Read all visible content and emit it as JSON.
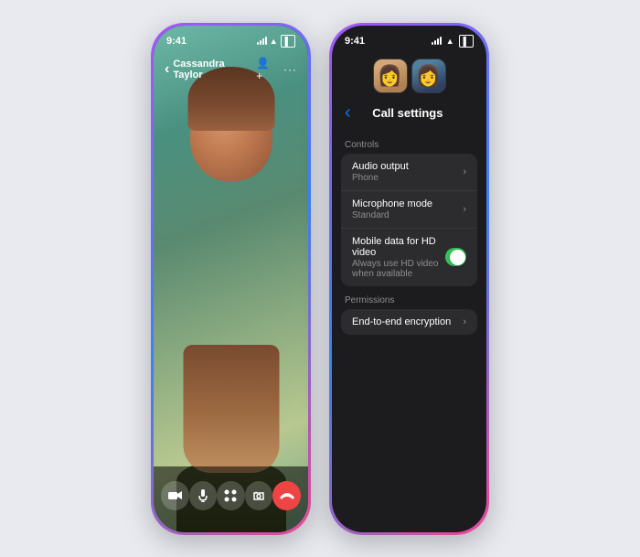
{
  "page": {
    "bg_color": "#e8eaf0"
  },
  "left_phone": {
    "status_bar": {
      "time": "9:41",
      "signal": "signal",
      "wifi": "wifi",
      "battery": "battery"
    },
    "call_header": {
      "back_label": "‹",
      "caller_name": "Cassandra Taylor",
      "add_person_icon": "add-person",
      "more_icon": "more"
    },
    "controls": [
      {
        "id": "camera",
        "icon": "🎥",
        "label": "camera-button"
      },
      {
        "id": "mic",
        "icon": "🎤",
        "label": "mic-button"
      },
      {
        "id": "effects",
        "icon": "⊞",
        "label": "effects-button"
      },
      {
        "id": "flip",
        "icon": "📷",
        "label": "flip-camera-button"
      },
      {
        "id": "end",
        "icon": "📞",
        "label": "end-call-button"
      }
    ]
  },
  "right_phone": {
    "status_bar": {
      "time": "9:41"
    },
    "header": {
      "back_label": "‹",
      "title": "Call settings"
    },
    "sections": [
      {
        "label": "Controls",
        "rows": [
          {
            "title": "Audio output",
            "subtitle": "Phone",
            "type": "disclosure"
          },
          {
            "title": "Microphone mode",
            "subtitle": "Standard",
            "type": "disclosure"
          },
          {
            "title": "Mobile data for HD video",
            "subtitle": "Always use HD video when available",
            "type": "toggle",
            "value": true
          }
        ]
      },
      {
        "label": "Permissions",
        "rows": [
          {
            "title": "End-to-end encryption",
            "subtitle": "",
            "type": "disclosure"
          }
        ]
      }
    ]
  }
}
